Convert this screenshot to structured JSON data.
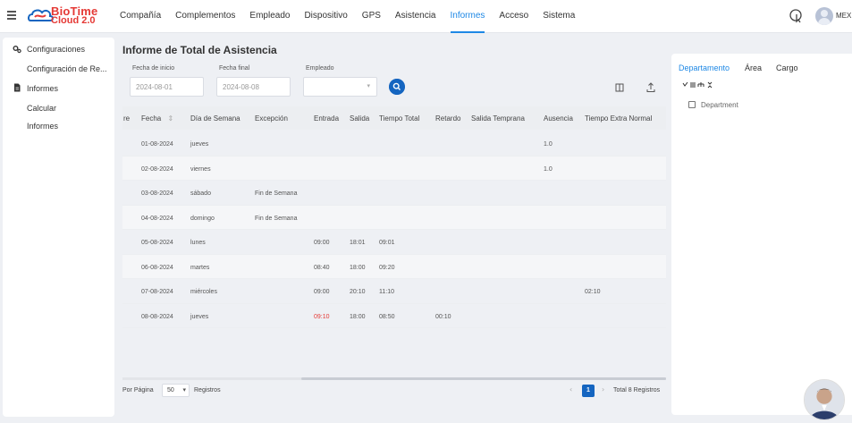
{
  "header": {
    "brand": {
      "line1": "BioTime",
      "line2": "Cloud 2.0"
    },
    "nav": [
      "Compañía",
      "Complementos",
      "Empleado",
      "Dispositivo",
      "GPS",
      "Asistencia",
      "Informes",
      "Acceso",
      "Sistema"
    ],
    "active_nav": "Informes",
    "user": "MEX"
  },
  "sidebar": {
    "items": [
      {
        "label": "Configuraciones",
        "icon": "gears-icon"
      },
      {
        "label": "Configuración de Re..."
      },
      {
        "label": "Informes",
        "icon": "document-icon"
      },
      {
        "label": "Calcular"
      },
      {
        "label": "Informes"
      }
    ]
  },
  "page": {
    "title": "Informe de Total de Asistencia",
    "filters": {
      "start_label": "Fecha de inicio",
      "start_value": "2024-08-01",
      "end_label": "Fecha final",
      "end_value": "2024-08-08",
      "employee_label": "Empleado",
      "employee_value": ""
    }
  },
  "table": {
    "columns": [
      "re",
      "Fecha",
      "Día de Semana",
      "Excepción",
      "Entrada",
      "Salida",
      "Tiempo Total",
      "Retardo",
      "Salida Temprana",
      "Ausencia",
      "Tiempo Extra Normal"
    ],
    "rows": [
      {
        "fecha": "01-08-2024",
        "dia": "jueves",
        "excepcion": "",
        "entrada": "",
        "salida": "",
        "total": "",
        "retardo": "",
        "temprana": "",
        "ausencia": "1.0",
        "extra": ""
      },
      {
        "fecha": "02-08-2024",
        "dia": "viernes",
        "excepcion": "",
        "entrada": "",
        "salida": "",
        "total": "",
        "retardo": "",
        "temprana": "",
        "ausencia": "1.0",
        "extra": ""
      },
      {
        "fecha": "03-08-2024",
        "dia": "sábado",
        "excepcion": "Fin de Semana",
        "entrada": "",
        "salida": "",
        "total": "",
        "retardo": "",
        "temprana": "",
        "ausencia": "",
        "extra": ""
      },
      {
        "fecha": "04-08-2024",
        "dia": "domingo",
        "excepcion": "Fin de Semana",
        "entrada": "",
        "salida": "",
        "total": "",
        "retardo": "",
        "temprana": "",
        "ausencia": "",
        "extra": ""
      },
      {
        "fecha": "05-08-2024",
        "dia": "lunes",
        "excepcion": "",
        "entrada": "09:00",
        "salida": "18:01",
        "total": "09:01",
        "retardo": "",
        "temprana": "",
        "ausencia": "",
        "extra": ""
      },
      {
        "fecha": "06-08-2024",
        "dia": "martes",
        "excepcion": "",
        "entrada": "08:40",
        "salida": "18:00",
        "total": "09:20",
        "retardo": "",
        "temprana": "",
        "ausencia": "",
        "extra": ""
      },
      {
        "fecha": "07-08-2024",
        "dia": "miércoles",
        "excepcion": "",
        "entrada": "09:00",
        "salida": "20:10",
        "total": "11:10",
        "retardo": "",
        "temprana": "",
        "ausencia": "",
        "extra": "02:10"
      },
      {
        "fecha": "08-08-2024",
        "dia": "jueves",
        "excepcion": "",
        "entrada": "09:10",
        "salida": "18:00",
        "total": "08:50",
        "retardo": "00:10",
        "temprana": "",
        "ausencia": "",
        "extra": ""
      }
    ],
    "late_color": "#e53935"
  },
  "footer": {
    "per_page_label": "Por Página",
    "per_page_value": "50",
    "records_label": "Registros",
    "current_page": "1",
    "total": "Total 8 Registros"
  },
  "right_panel": {
    "tabs": [
      "Departamento",
      "Área",
      "Cargo"
    ],
    "active_tab": "Departamento",
    "tree_root": "Department"
  },
  "colors": {
    "accent": "#1e88e5",
    "primary_button": "#1565c0",
    "brand": "#e53935"
  }
}
